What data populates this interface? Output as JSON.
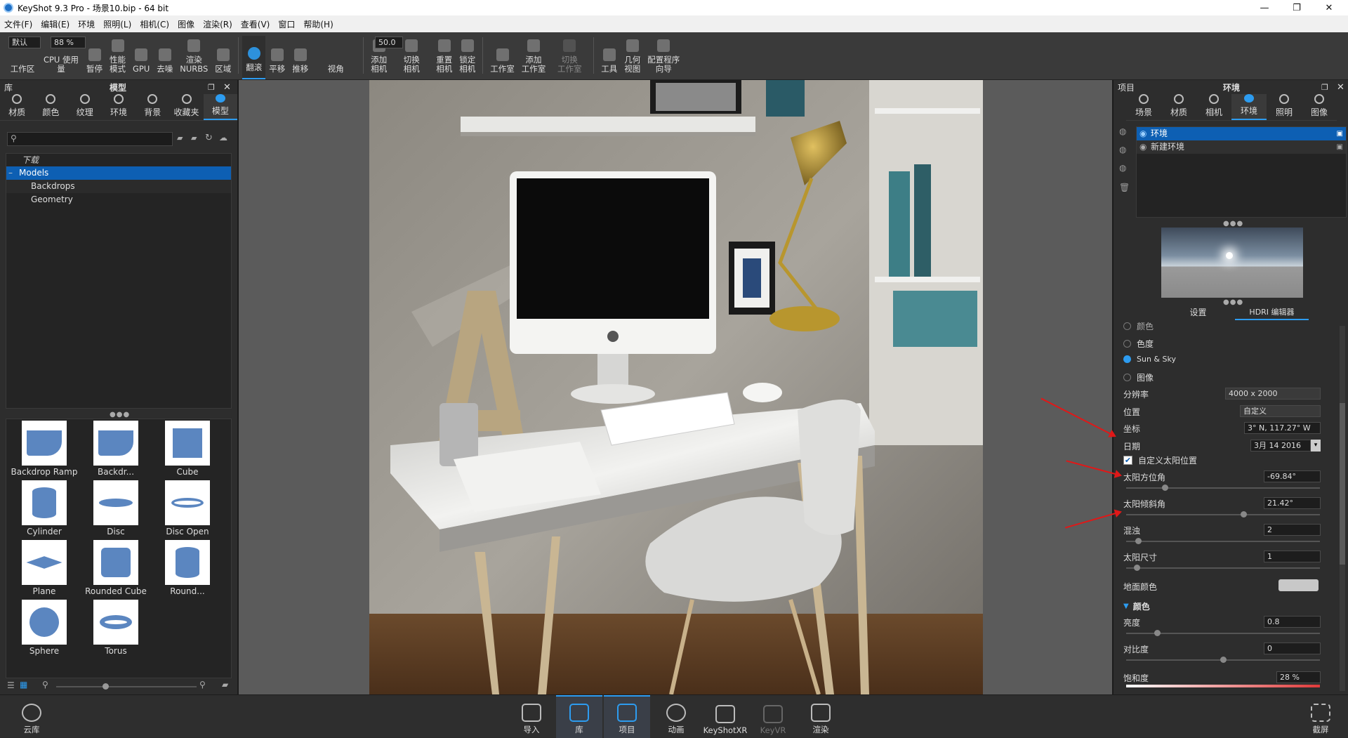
{
  "title": "KeyShot 9.3 Pro  - 场景10.bip  - 64 bit",
  "menu": [
    "文件(F)",
    "编辑(E)",
    "环境",
    "照明(L)",
    "相机(C)",
    "图像",
    "渲染(R)",
    "查看(V)",
    "窗口",
    "帮助(H)"
  ],
  "toolbar": {
    "preset": "默认",
    "cpu_pct": "88 %",
    "fov": "50.0",
    "items": [
      "工作区",
      "CPU 使用量",
      "暂停",
      "性能\n模式",
      "GPU",
      "去噪",
      "渲染\nNURBS",
      "区域",
      "翻滚",
      "平移",
      "推移",
      "视角",
      "添加\n相机",
      "切换\n相机",
      "重置\n相机",
      "锁定\n相机",
      "工作室",
      "添加\n工作室",
      "切换\n工作室",
      "工具",
      "几何\n视图",
      "配置程序\n向导"
    ]
  },
  "library": {
    "header_left": "库",
    "header_title": "模型",
    "tabs": [
      "材质",
      "颜色",
      "纹理",
      "环境",
      "背景",
      "收藏夹",
      "模型"
    ],
    "tree": [
      "下载",
      "Models",
      "Backdrops",
      "Geometry"
    ],
    "models": [
      "Backdrop Ramp",
      "Backdr...",
      "Cube",
      "Cylinder",
      "Disc",
      "Disc Open",
      "Plane",
      "Rounded Cube",
      "Round...",
      "Sphere",
      "Torus"
    ]
  },
  "project": {
    "header_left": "项目",
    "header_title": "环境",
    "tabs": [
      "场景",
      "材质",
      "相机",
      "环境",
      "照明",
      "图像"
    ],
    "env_list": [
      "环境",
      "新建环境"
    ],
    "subtabs": [
      "设置",
      "HDRI 编辑器"
    ],
    "bg_options": [
      "颜色",
      "色度",
      "Sun & Sky",
      "图像"
    ],
    "labels": {
      "resolution": "分辨率",
      "position": "位置",
      "coords": "坐标",
      "date": "日期",
      "custom_sun": "自定义太阳位置",
      "azimuth": "太阳方位角",
      "inclination": "太阳倾斜角",
      "turbidity": "混浊",
      "sun_size": "太阳尺寸",
      "ground_color": "地面颜色",
      "color_section": "颜色",
      "brightness": "亮度",
      "contrast": "对比度",
      "saturation": "饱和度"
    },
    "values": {
      "resolution": "4000 x 2000",
      "position": "自定义",
      "coords": "3° N, 117.27° W",
      "date": "3月 14 2016",
      "azimuth": "-69.84°",
      "inclination": "21.42°",
      "turbidity": "2",
      "sun_size": "1",
      "brightness": "0.8",
      "contrast": "0",
      "saturation": "28 %"
    },
    "slider_levels": {
      "azimuth": 0.19,
      "inclination": 0.61,
      "turbidity": 0.05,
      "sun_size": 0.04,
      "brightness": 0.15,
      "contrast": 0.5
    }
  },
  "bottom": [
    "云库",
    "导入",
    "库",
    "项目",
    "动画",
    "KeyShotXR",
    "KeyVR",
    "渲染",
    "截屏"
  ],
  "colors": {
    "accent": "#2d9cf0",
    "arrow": "#e01818",
    "saturation_bar": "#e03a3a"
  }
}
